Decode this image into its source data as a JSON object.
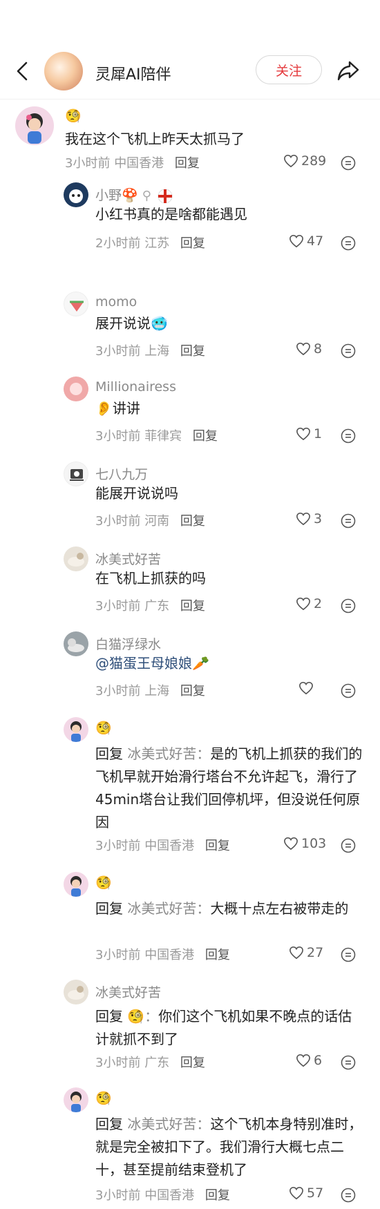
{
  "header": {
    "title": "灵犀AI陪伴",
    "follow_label": "关注"
  },
  "comments": [
    {
      "name": "🧐",
      "text": "我在这个飞机上昨天太抓马了",
      "time": "3小时前",
      "location": "中国香港",
      "reply_label": "回复",
      "likes": "289"
    },
    {
      "name": "小野🍄",
      "text": "小红书真的是啥都能遇见",
      "time": "2小时前",
      "location": "江苏",
      "reply_label": "回复",
      "likes": "47"
    },
    {
      "name": "momo",
      "text": "展开说说🥶",
      "time": "3小时前",
      "location": "上海",
      "reply_label": "回复",
      "likes": "8"
    },
    {
      "name": "Millionairess",
      "text": "👂讲讲",
      "time": "3小时前",
      "location": "菲律宾",
      "reply_label": "回复",
      "likes": "1"
    },
    {
      "name": "七八九万",
      "text": "能展开说说吗",
      "time": "3小时前",
      "location": "河南",
      "reply_label": "回复",
      "likes": "3"
    },
    {
      "name": "冰美式好苦",
      "text": "在飞机上抓获的吗",
      "time": "3小时前",
      "location": "广东",
      "reply_label": "回复",
      "likes": "2"
    },
    {
      "name": "白猫浮绿水",
      "text": "@猫蛋王母娘娘🥕",
      "time": "3小时前",
      "location": "上海",
      "reply_label": "回复",
      "likes": ""
    },
    {
      "name": "🧐",
      "reply_prefix": "回复",
      "reply_target": "冰美式好苦：",
      "text": "是的飞机上抓获的我们的飞机早就开始滑行塔台不允许起飞，滑行了45min塔台让我们回停机坪，但没说任何原因",
      "time": "3小时前",
      "location": "中国香港",
      "reply_label": "回复",
      "likes": "103"
    },
    {
      "name": "🧐",
      "reply_prefix": "回复",
      "reply_target": "冰美式好苦：",
      "text": "大概十点左右被带走的",
      "time": "3小时前",
      "location": "中国香港",
      "reply_label": "回复",
      "likes": "27"
    },
    {
      "name": "冰美式好苦",
      "reply_prefix": "回复",
      "reply_target": "🧐：",
      "text": "你们这个飞机如果不晚点的话估计就抓不到了",
      "time": "3小时前",
      "location": "广东",
      "reply_label": "回复",
      "likes": "6"
    },
    {
      "name": "🧐",
      "reply_prefix": "回复",
      "reply_target": "冰美式好苦：",
      "text": "这个飞机本身特别准时，就是完全被扣下了。我们滑行大概七点二十，甚至提前结束登机了",
      "time": "3小时前",
      "location": "中国香港",
      "reply_label": "回复",
      "likes": "57"
    }
  ]
}
